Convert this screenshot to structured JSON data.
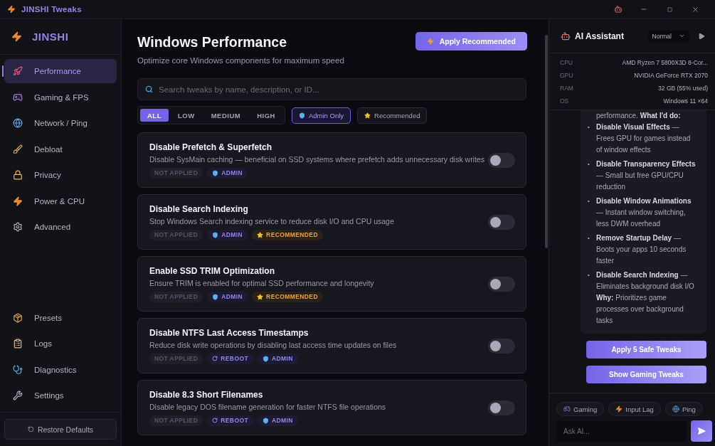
{
  "window": {
    "title": "JINSHI Tweaks"
  },
  "sidebar": {
    "brand": "JINSHI",
    "items": [
      {
        "label": "Performance",
        "selected": true
      },
      {
        "label": "Gaming & FPS",
        "selected": false
      },
      {
        "label": "Network / Ping",
        "selected": false
      },
      {
        "label": "Debloat",
        "selected": false
      },
      {
        "label": "Privacy",
        "selected": false
      },
      {
        "label": "Power & CPU",
        "selected": false
      },
      {
        "label": "Advanced",
        "selected": false
      }
    ],
    "bottom_items": [
      {
        "label": "Presets",
        "selected": false
      },
      {
        "label": "Logs",
        "selected": false
      },
      {
        "label": "Diagnostics",
        "selected": false
      },
      {
        "label": "Settings",
        "selected": false
      }
    ],
    "restore_button": "Restore Defaults"
  },
  "main": {
    "title": "Windows Performance",
    "subtitle": "Optimize core Windows components for maximum speed",
    "apply_button": "Apply Recommended",
    "search": {
      "placeholder": "Search tweaks by name, description, or ID..."
    },
    "levels": [
      {
        "label": "ALL",
        "selected": true
      },
      {
        "label": "LOW",
        "selected": false
      },
      {
        "label": "MEDIUM",
        "selected": false
      },
      {
        "label": "HIGH",
        "selected": false
      }
    ],
    "filters": [
      {
        "kind": "admin",
        "label": "Admin Only",
        "selected": true
      },
      {
        "kind": "recommended",
        "label": "Recommended",
        "selected": false
      }
    ],
    "tweaks": [
      {
        "title": "Disable Prefetch & Superfetch",
        "description": "Disable SysMain caching — beneficial on SSD systems where prefetch adds unnecessary disk writes",
        "on": false,
        "tags": [
          {
            "kind": "status",
            "label": "NOT APPLIED"
          },
          {
            "kind": "admin",
            "label": "ADMIN"
          }
        ]
      },
      {
        "title": "Disable Search Indexing",
        "description": "Stop Windows Search indexing service to reduce disk I/O and CPU usage",
        "on": false,
        "tags": [
          {
            "kind": "status",
            "label": "NOT APPLIED"
          },
          {
            "kind": "admin",
            "label": "ADMIN"
          },
          {
            "kind": "recommended",
            "label": "RECOMMENDED"
          }
        ]
      },
      {
        "title": "Enable SSD TRIM Optimization",
        "description": "Ensure TRIM is enabled for optimal SSD performance and longevity",
        "on": false,
        "tags": [
          {
            "kind": "status",
            "label": "NOT APPLIED"
          },
          {
            "kind": "admin",
            "label": "ADMIN"
          },
          {
            "kind": "recommended",
            "label": "RECOMMENDED"
          }
        ]
      },
      {
        "title": "Disable NTFS Last Access Timestamps",
        "description": "Reduce disk write operations by disabling last access time updates on files",
        "on": false,
        "tags": [
          {
            "kind": "status",
            "label": "NOT APPLIED"
          },
          {
            "kind": "reboot",
            "label": "REBOOT"
          },
          {
            "kind": "admin",
            "label": "ADMIN"
          }
        ]
      },
      {
        "title": "Disable 8.3 Short Filenames",
        "description": "Disable legacy DOS filename generation for faster NTFS file operations",
        "on": false,
        "tags": [
          {
            "kind": "status",
            "label": "NOT APPLIED"
          },
          {
            "kind": "reboot",
            "label": "REBOOT"
          },
          {
            "kind": "admin",
            "label": "ADMIN"
          }
        ]
      }
    ]
  },
  "assistant": {
    "title": "AI Assistant",
    "mode": "Normal",
    "specs": [
      {
        "label": "CPU",
        "value": "AMD Ryzen 7 5800X3D 8-Cor..."
      },
      {
        "label": "GPU",
        "value": "NVIDIA GeForce RTX 2070"
      },
      {
        "label": "RAM",
        "value": "32 GB (55% used)"
      },
      {
        "label": "OS",
        "value": "Windows 11 ×64"
      }
    ],
    "message": {
      "intro": "performance. **What I'd do:**",
      "items": [
        {
          "marker": "•",
          "text": "**Disable Visual Effects** — Frees GPU for games instead of window effects"
        },
        {
          "marker": "•",
          "text": "**Disable Transparency Effects** — Small but free GPU/CPU reduction"
        },
        {
          "marker": "•",
          "text": "**Disable Window Animations** — Instant window switching, less DWM overhead"
        },
        {
          "marker": "•",
          "text": "**Remove Startup Delay** — Boots your apps 10 seconds faster"
        },
        {
          "marker": "•",
          "text": "**Disable Search Indexing** — Eliminates background disk I/O"
        }
      ],
      "footer": "**Why:** Prioritizes game processes over background tasks"
    },
    "actions": [
      "Apply 5 Safe Tweaks",
      "Show Gaming Tweaks"
    ],
    "chips": [
      {
        "kind": "gaming",
        "label": "Gaming"
      },
      {
        "kind": "input",
        "label": "Input Lag"
      },
      {
        "kind": "ping",
        "label": "Ping"
      }
    ],
    "input": {
      "placeholder": "Ask AI..."
    }
  }
}
